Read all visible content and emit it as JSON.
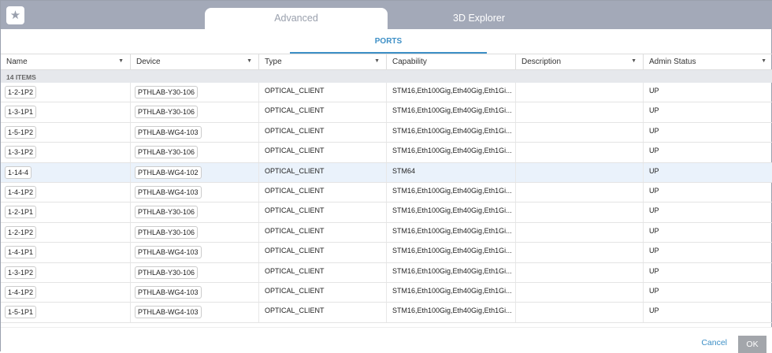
{
  "tabs": {
    "active": "Advanced",
    "inactive": "3D Explorer"
  },
  "subtab": "PORTS",
  "columns": [
    "Name",
    "Device",
    "Type",
    "Capability",
    "Description",
    "Admin Status"
  ],
  "items_count": "14 ITEMS",
  "rows": [
    [
      "1-2-1P2",
      "PTHLAB-Y30-106",
      "OPTICAL_CLIENT",
      "STM16,Eth100Gig,Eth40Gig,Eth1Gi...",
      "",
      "UP"
    ],
    [
      "1-3-1P1",
      "PTHLAB-Y30-106",
      "OPTICAL_CLIENT",
      "STM16,Eth100Gig,Eth40Gig,Eth1Gi...",
      "",
      "UP"
    ],
    [
      "1-5-1P2",
      "PTHLAB-WG4-103",
      "OPTICAL_CLIENT",
      "STM16,Eth100Gig,Eth40Gig,Eth1Gi...",
      "",
      "UP"
    ],
    [
      "1-3-1P2",
      "PTHLAB-Y30-106",
      "OPTICAL_CLIENT",
      "STM16,Eth100Gig,Eth40Gig,Eth1Gi...",
      "",
      "UP"
    ],
    [
      "1-14-4",
      "PTHLAB-WG4-102",
      "OPTICAL_CLIENT",
      "STM64",
      "",
      "UP"
    ],
    [
      "1-4-1P2",
      "PTHLAB-WG4-103",
      "OPTICAL_CLIENT",
      "STM16,Eth100Gig,Eth40Gig,Eth1Gi...",
      "",
      "UP"
    ],
    [
      "1-2-1P1",
      "PTHLAB-Y30-106",
      "OPTICAL_CLIENT",
      "STM16,Eth100Gig,Eth40Gig,Eth1Gi...",
      "",
      "UP"
    ],
    [
      "1-2-1P2",
      "PTHLAB-Y30-106",
      "OPTICAL_CLIENT",
      "STM16,Eth100Gig,Eth40Gig,Eth1Gi...",
      "",
      "UP"
    ],
    [
      "1-4-1P1",
      "PTHLAB-WG4-103",
      "OPTICAL_CLIENT",
      "STM16,Eth100Gig,Eth40Gig,Eth1Gi...",
      "",
      "UP"
    ],
    [
      "1-3-1P2",
      "PTHLAB-Y30-106",
      "OPTICAL_CLIENT",
      "STM16,Eth100Gig,Eth40Gig,Eth1Gi...",
      "",
      "UP"
    ],
    [
      "1-4-1P2",
      "PTHLAB-WG4-103",
      "OPTICAL_CLIENT",
      "STM16,Eth100Gig,Eth40Gig,Eth1Gi...",
      "",
      "UP"
    ],
    [
      "1-5-1P1",
      "PTHLAB-WG4-103",
      "OPTICAL_CLIENT",
      "STM16,Eth100Gig,Eth40Gig,Eth1Gi...",
      "",
      "UP"
    ]
  ],
  "footer": {
    "cancel": "Cancel",
    "ok": "OK"
  }
}
